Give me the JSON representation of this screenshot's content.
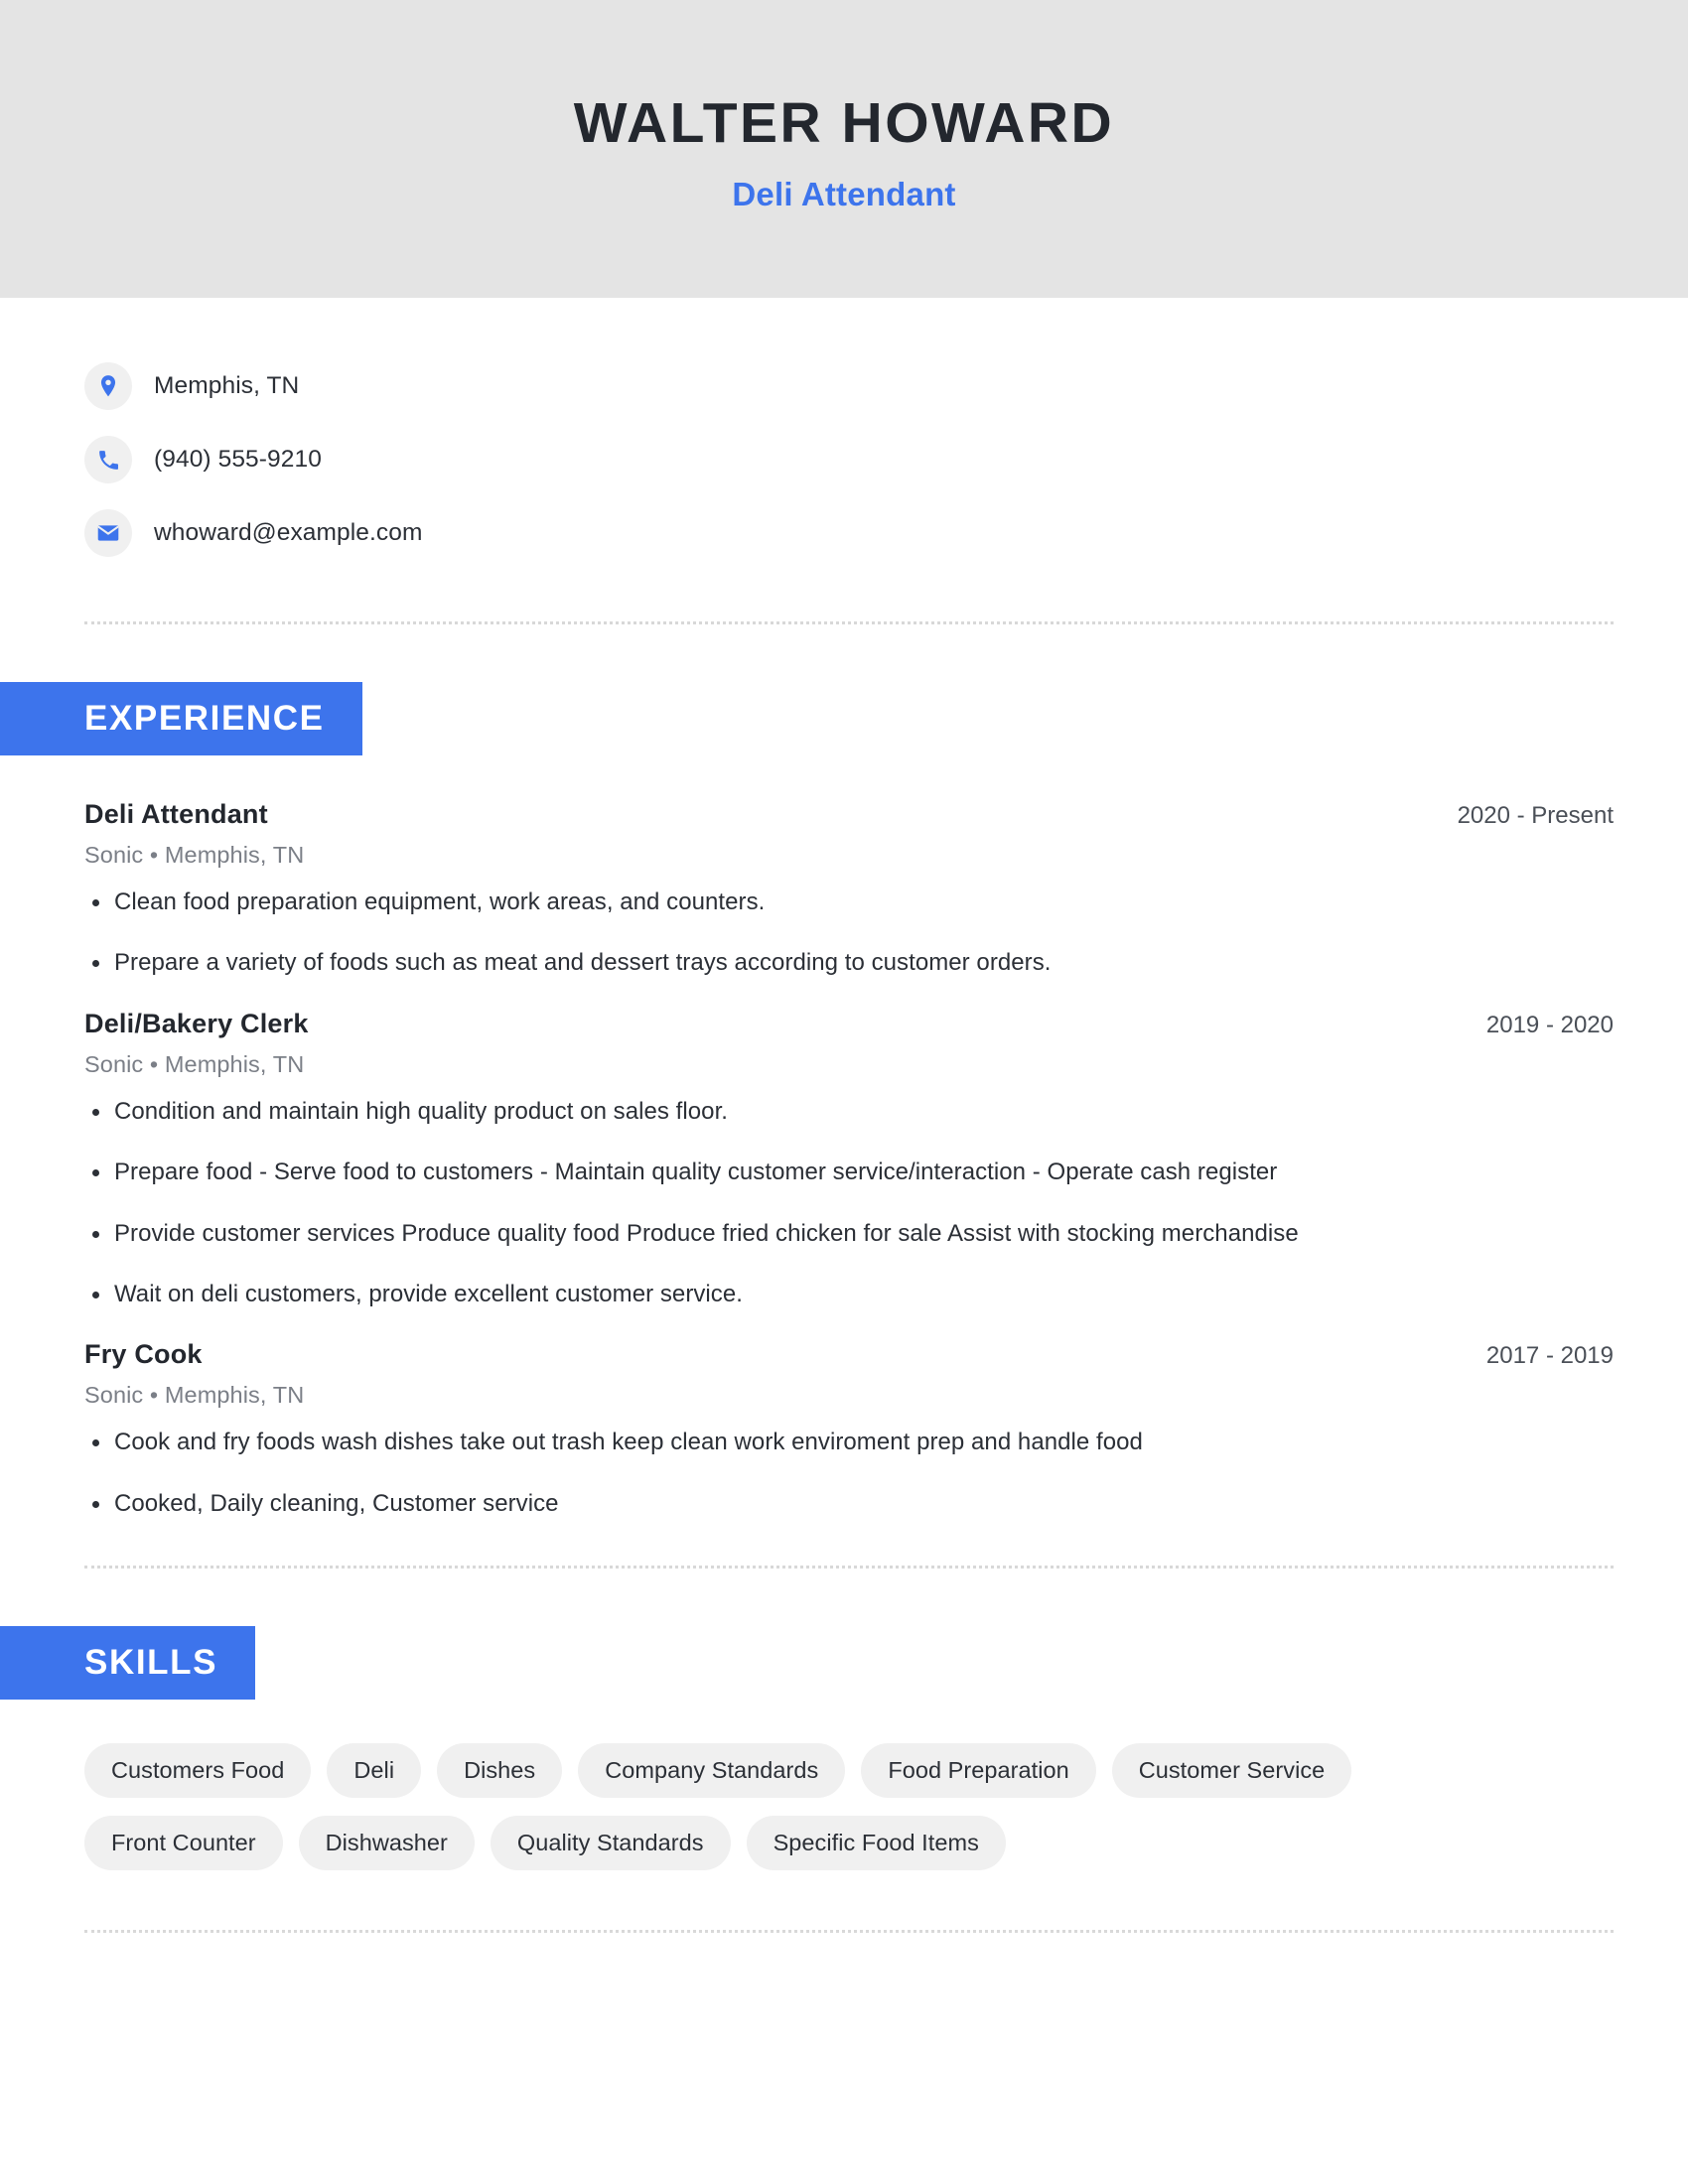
{
  "header": {
    "name": "WALTER HOWARD",
    "job_title": "Deli Attendant",
    "background_color": "#e4e4e4",
    "accent_color": "#3d74ec"
  },
  "contact": {
    "location": {
      "icon": "location-pin-icon",
      "text": "Memphis, TN"
    },
    "phone": {
      "icon": "phone-icon",
      "text": "(940) 555-9210"
    },
    "email": {
      "icon": "envelope-icon",
      "text": "whoward@example.com"
    }
  },
  "experience": {
    "section_label": "EXPERIENCE",
    "items": [
      {
        "role": "Deli Attendant",
        "dates": "2020 - Present",
        "meta": "Sonic  • Memphis, TN",
        "bullets": [
          "Clean food preparation equipment, work areas, and counters.",
          "Prepare a variety of foods such as meat and dessert trays according to customer orders."
        ]
      },
      {
        "role": "Deli/Bakery Clerk",
        "dates": "2019 - 2020",
        "meta": "Sonic  • Memphis, TN",
        "bullets": [
          "Condition and maintain high quality product on sales floor.",
          "Prepare food - Serve food to customers - Maintain quality customer service/interaction - Operate cash register",
          "Provide customer services Produce quality food Produce fried chicken for sale Assist with stocking merchandise",
          "Wait on deli customers, provide excellent customer service."
        ]
      },
      {
        "role": "Fry Cook",
        "dates": "2017 - 2019",
        "meta": "Sonic  • Memphis, TN",
        "bullets": [
          "Cook and fry foods wash dishes take out trash keep clean work enviroment prep and handle food",
          "Cooked, Daily cleaning, Customer service"
        ]
      }
    ]
  },
  "skills": {
    "section_label": "SKILLS",
    "items": [
      "Customers Food",
      "Deli",
      "Dishes",
      "Company Standards",
      "Food Preparation",
      "Customer Service",
      "Front Counter",
      "Dishwasher",
      "Quality Standards",
      "Specific Food Items"
    ]
  }
}
